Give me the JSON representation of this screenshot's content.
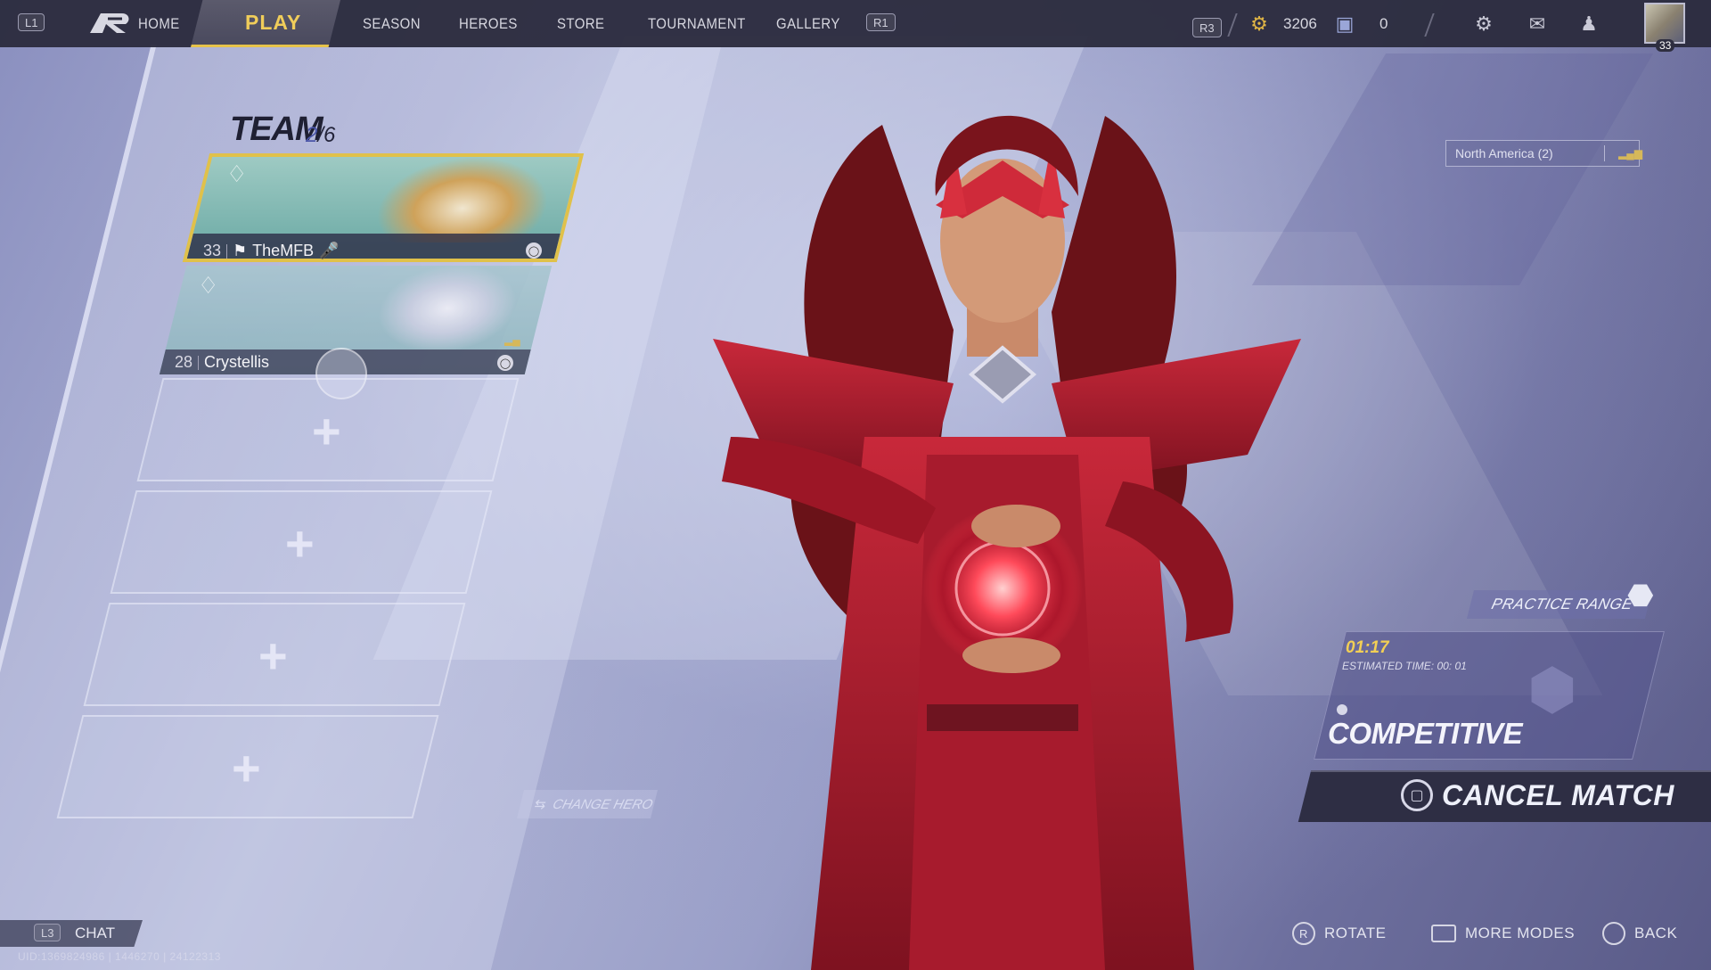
{
  "nav": {
    "left_key": "L1",
    "home_label": "HOME",
    "play_label": "PLAY",
    "season_label": "SEASON",
    "heroes_label": "HEROES",
    "store_label": "STORE",
    "tournament_label": "TOURNAMENT",
    "gallery_label": "GALLERY",
    "right_key": "R1"
  },
  "resources": {
    "r3_key": "R3",
    "currency_1": "3206",
    "currency_2": "0"
  },
  "profile": {
    "level": "33"
  },
  "team": {
    "title": "TEAM",
    "count_current": "2",
    "count_sep": "/",
    "count_max": "6",
    "members": [
      {
        "level": "33",
        "name": "TheMFB"
      },
      {
        "level": "28",
        "name": "Crystellis"
      }
    ],
    "empty_slot_symbol": "+"
  },
  "change_hero_label": "CHANGE HERO",
  "region": {
    "label": "North America (2)"
  },
  "practice_range_label": "PRACTICE RANGE",
  "queue": {
    "elapsed": "01:17",
    "estimated": "ESTIMATED TIME: 00: 01",
    "mode": "COMPETITIVE"
  },
  "cancel_label": "CANCEL MATCH",
  "hints": {
    "rotate_key": "R",
    "rotate_label": "ROTATE",
    "more_modes_label": "MORE MODES",
    "back_label": "BACK"
  },
  "chat": {
    "key": "L3",
    "label": "CHAT"
  },
  "uid_text": "UID:1369824986 | 1446270 | 24122313"
}
